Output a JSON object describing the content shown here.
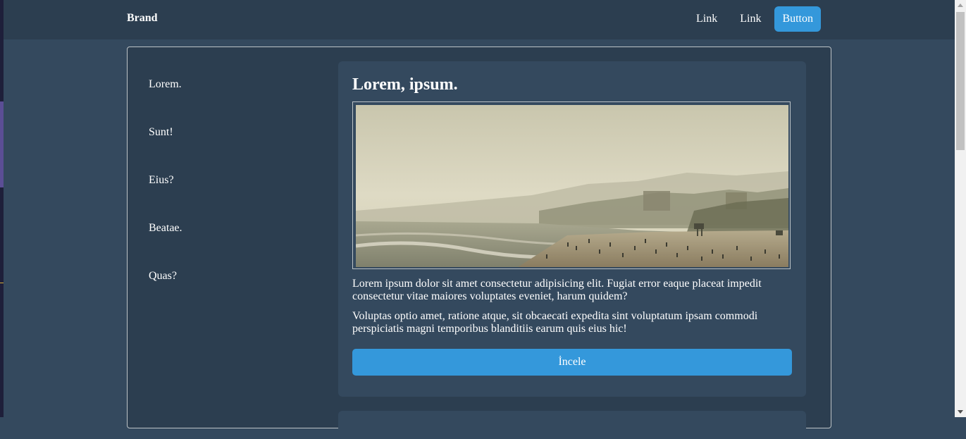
{
  "navbar": {
    "brand": "Brand",
    "links": [
      "Link",
      "Link"
    ],
    "button_label": "Button"
  },
  "sidebar": {
    "items": [
      "Lorem.",
      "Sunt!",
      "Eius?",
      "Beatae.",
      "Quas?"
    ]
  },
  "card": {
    "title": "Lorem, ipsum.",
    "image": "beach-photo",
    "paragraphs": [
      "Lorem ipsum dolor sit amet consectetur adipisicing elit. Fugiat error eaque placeat impedit consectetur vitae maiores voluptates eveniet, harum quidem?",
      "Voluptas optio amet, ratione atque, sit obcaecati expedita sint voluptatum ipsam commodi perspiciatis magni temporibus blanditiis earum quis eius hic!"
    ],
    "button_label": "İncele"
  },
  "colors": {
    "page_bg": "#34495e",
    "panel_bg": "#2c3e50",
    "accent": "#3498db"
  }
}
